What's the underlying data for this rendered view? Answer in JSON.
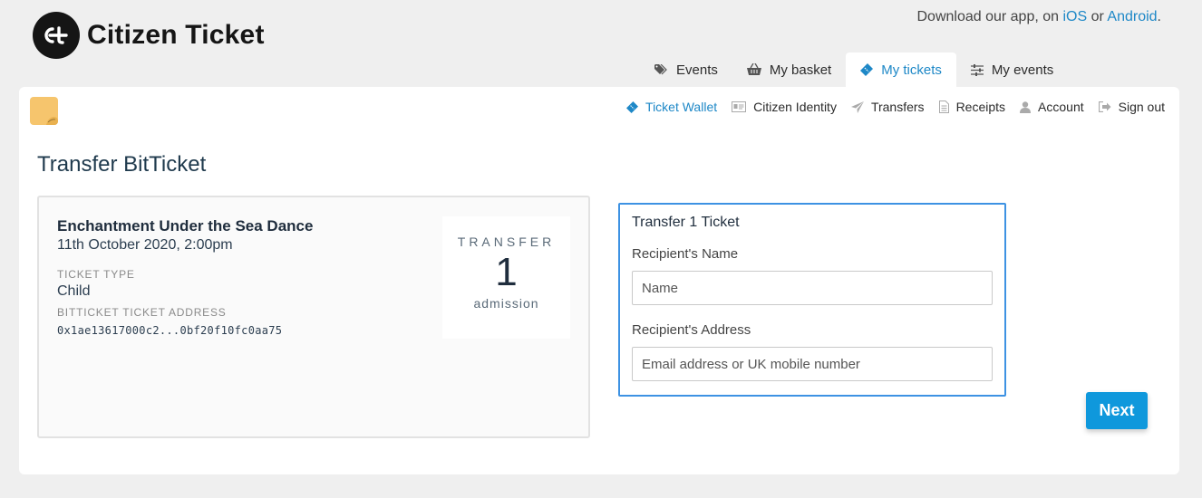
{
  "brand": {
    "name": "Citizen Ticket"
  },
  "app_promo": {
    "prefix": "Download our app, on ",
    "ios": "iOS",
    "or": " or ",
    "android": "Android",
    "suffix": "."
  },
  "tabs": [
    {
      "label": "Events",
      "icon": "tags-icon"
    },
    {
      "label": "My basket",
      "icon": "basket-icon"
    },
    {
      "label": "My tickets",
      "icon": "ticket-icon",
      "active": true
    },
    {
      "label": "My events",
      "icon": "sliders-icon"
    }
  ],
  "subnav": [
    {
      "label": "Ticket Wallet",
      "icon": "ticket-icon",
      "active": true
    },
    {
      "label": "Citizen Identity",
      "icon": "id-card-icon"
    },
    {
      "label": "Transfers",
      "icon": "paper-plane-icon"
    },
    {
      "label": "Receipts",
      "icon": "document-icon"
    },
    {
      "label": "Account",
      "icon": "user-icon"
    },
    {
      "label": "Sign out",
      "icon": "sign-out-icon"
    }
  ],
  "page_title": "Transfer BitTicket",
  "ticket": {
    "event_name": "Enchantment Under the Sea Dance",
    "date": "11th October 2020, 2:00pm",
    "type_label": "TICKET TYPE",
    "type_value": "Child",
    "address_label": "BITTICKET TICKET ADDRESS",
    "address_value": "0x1ae13617000c2...0bf20f10fc0aa75",
    "badge_top": "TRANSFER",
    "badge_count": "1",
    "badge_bottom": "admission"
  },
  "form": {
    "title": "Transfer 1 Ticket",
    "name_label": "Recipient's Name",
    "name_placeholder": "Name",
    "name_value": "",
    "address_label": "Recipient's Address",
    "address_placeholder": "Email address or UK mobile number",
    "address_value": ""
  },
  "next_button": "Next",
  "colors": {
    "accent": "#1e88c7",
    "button": "#0f98dc",
    "form_border": "#3d92e3",
    "avatar": "#f6c56d"
  }
}
